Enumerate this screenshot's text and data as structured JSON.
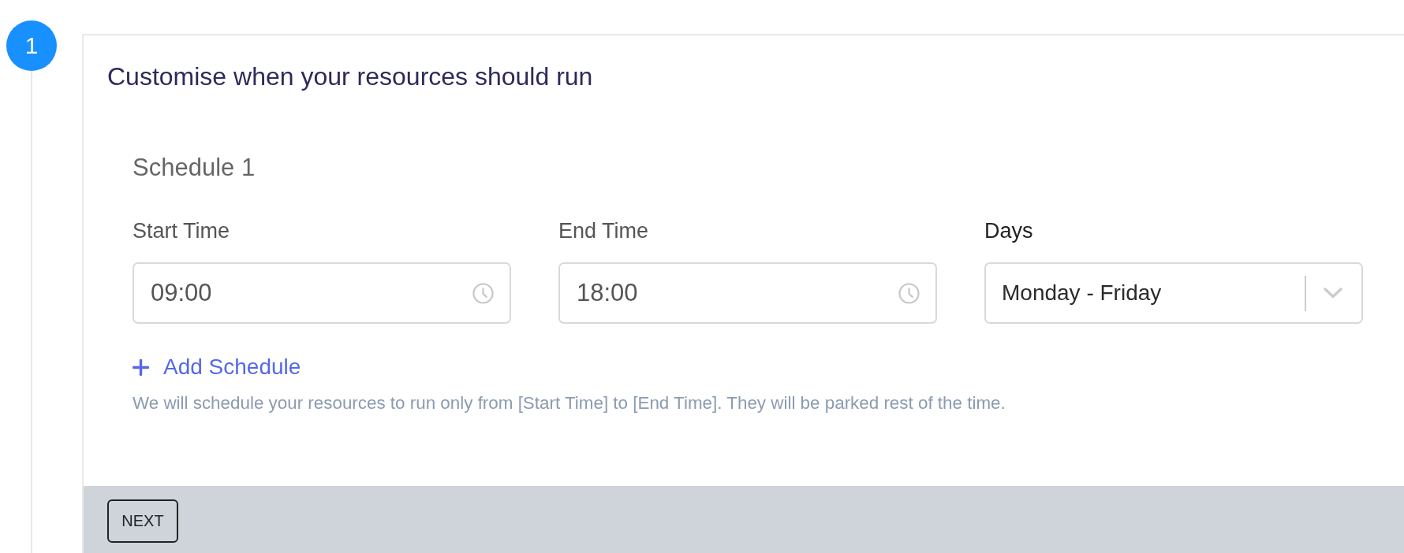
{
  "step": {
    "number": "1"
  },
  "card": {
    "title": "Customise when your resources should run",
    "schedules": [
      {
        "title": "Schedule 1",
        "fields": [
          {
            "kind": "time",
            "label": "Start Time",
            "value": "09:00"
          },
          {
            "kind": "time",
            "label": "End Time",
            "value": "18:00"
          },
          {
            "kind": "select",
            "label": "Days",
            "value": "Monday - Friday"
          }
        ]
      }
    ],
    "add_schedule": {
      "label": "Add Schedule"
    },
    "help_text": "We will schedule your resources to run only from [Start Time] to [End Time]. They will be parked rest of the time.",
    "footer": {
      "buttons": [
        "NEXT"
      ]
    }
  }
}
